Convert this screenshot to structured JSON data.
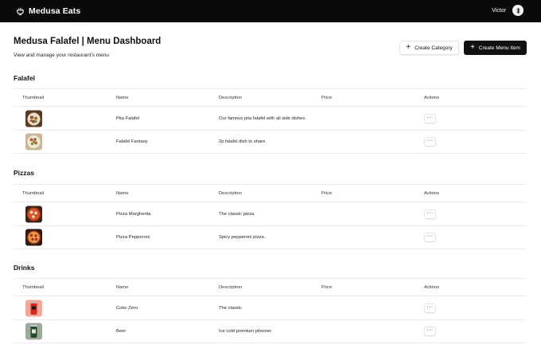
{
  "header": {
    "brand": "Medusa Eats",
    "user_name": "Victor",
    "logo_icon": "fork-icon",
    "avatar_icon": "avatar-icon"
  },
  "page": {
    "title": "Medusa Falafel | Menu Dashboard",
    "subtitle": "View and manage your restaurant's menu",
    "create_category": "Create Category",
    "create_menu_item": "Create Menu Item"
  },
  "columns": {
    "thumbnail": "Thumbnail",
    "name": "Name",
    "description": "Description",
    "price": "Price",
    "actions": "Actions"
  },
  "actions_label": "···",
  "categories": [
    {
      "title": "Falafel",
      "items": [
        {
          "name": "Pita Falafel",
          "description": "Our famous pita falafel with all side dishes.",
          "price": "",
          "thumb": "falafel-plate"
        },
        {
          "name": "Falafel Fantasy",
          "description": "2p falafel dish to share.",
          "price": "",
          "thumb": "falafel-plate"
        }
      ]
    },
    {
      "title": "Pizzas",
      "items": [
        {
          "name": "Pizza Margherita",
          "description": "The classic pizza.",
          "price": "",
          "thumb": "pizza"
        },
        {
          "name": "Pizza Pepperoni",
          "description": "Spicy pepperoni pizza.",
          "price": "",
          "thumb": "pizza"
        }
      ]
    },
    {
      "title": "Drinks",
      "items": [
        {
          "name": "Coke Zero",
          "description": "The classic",
          "price": "",
          "thumb": "soda-can"
        },
        {
          "name": "Beer",
          "description": "Ice cold premium pilsener.",
          "price": "",
          "thumb": "beer-can"
        }
      ]
    }
  ]
}
